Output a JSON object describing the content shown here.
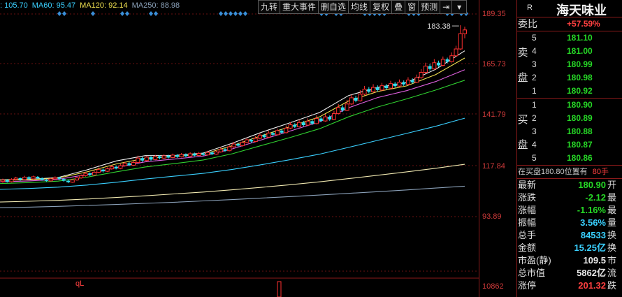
{
  "ma_legend": [
    {
      "label": ": 105.70",
      "color": "#3ad0ff"
    },
    {
      "label": "MA60: 95.47",
      "color": "#3ad0ff"
    },
    {
      "label": "MA120: 92.14",
      "color": "#f0e050"
    },
    {
      "label": "MA250: 88.98",
      "color": "#8aa0b8"
    }
  ],
  "toolbar": [
    "九转",
    "重大事件",
    "删自选",
    "均线",
    "复权",
    "叠",
    "窗",
    "预测"
  ],
  "price_axis": [
    "189.35",
    "165.73",
    "141.79",
    "117.84",
    "93.89",
    "10862"
  ],
  "chart": {
    "high_label": "183.38",
    "indicator_label": "qL",
    "price_min": 80.0,
    "price_max": 189.35,
    "candles": [
      {
        "o": 100.5,
        "c": 101.2,
        "h": 102.0,
        "l": 99.8
      },
      {
        "o": 101.2,
        "c": 100.4,
        "h": 101.8,
        "l": 99.9
      },
      {
        "o": 100.4,
        "c": 101.6,
        "h": 102.2,
        "l": 100.0
      },
      {
        "o": 101.6,
        "c": 102.3,
        "h": 103.0,
        "l": 101.0
      },
      {
        "o": 102.3,
        "c": 101.5,
        "h": 102.6,
        "l": 100.8
      },
      {
        "o": 101.5,
        "c": 102.8,
        "h": 103.5,
        "l": 101.2
      },
      {
        "o": 102.8,
        "c": 101.9,
        "h": 103.3,
        "l": 101.4
      },
      {
        "o": 101.9,
        "c": 103.0,
        "h": 103.6,
        "l": 101.5
      },
      {
        "o": 103.0,
        "c": 102.2,
        "h": 103.4,
        "l": 101.8
      },
      {
        "o": 102.2,
        "c": 101.4,
        "h": 102.7,
        "l": 100.9
      },
      {
        "o": 101.4,
        "c": 100.8,
        "h": 101.9,
        "l": 100.2
      },
      {
        "o": 100.8,
        "c": 101.9,
        "h": 102.3,
        "l": 100.5
      },
      {
        "o": 101.9,
        "c": 102.6,
        "h": 103.2,
        "l": 101.5
      },
      {
        "o": 102.6,
        "c": 101.8,
        "h": 103.0,
        "l": 101.3
      },
      {
        "o": 101.8,
        "c": 100.9,
        "h": 102.2,
        "l": 100.4
      },
      {
        "o": 100.9,
        "c": 100.1,
        "h": 101.4,
        "l": 99.6
      },
      {
        "o": 100.1,
        "c": 101.3,
        "h": 101.9,
        "l": 99.8
      },
      {
        "o": 101.3,
        "c": 102.4,
        "h": 102.9,
        "l": 100.9
      },
      {
        "o": 102.4,
        "c": 103.6,
        "h": 104.2,
        "l": 102.0
      },
      {
        "o": 103.6,
        "c": 104.8,
        "h": 105.6,
        "l": 103.1
      },
      {
        "o": 104.8,
        "c": 103.9,
        "h": 105.3,
        "l": 103.4
      },
      {
        "o": 103.9,
        "c": 105.4,
        "h": 106.2,
        "l": 103.5
      },
      {
        "o": 105.4,
        "c": 106.8,
        "h": 107.9,
        "l": 105.0
      },
      {
        "o": 106.8,
        "c": 105.9,
        "h": 107.4,
        "l": 105.2
      },
      {
        "o": 105.9,
        "c": 107.2,
        "h": 108.0,
        "l": 105.5
      },
      {
        "o": 107.2,
        "c": 108.3,
        "h": 109.1,
        "l": 106.7
      },
      {
        "o": 108.3,
        "c": 107.4,
        "h": 109.0,
        "l": 106.9
      },
      {
        "o": 107.4,
        "c": 108.9,
        "h": 109.8,
        "l": 107.0
      },
      {
        "o": 108.9,
        "c": 110.2,
        "h": 111.0,
        "l": 108.4
      },
      {
        "o": 110.2,
        "c": 109.1,
        "h": 110.9,
        "l": 108.6
      },
      {
        "o": 109.1,
        "c": 110.6,
        "h": 111.5,
        "l": 108.8
      },
      {
        "o": 110.6,
        "c": 112.9,
        "h": 114.2,
        "l": 110.1
      },
      {
        "o": 112.9,
        "c": 111.6,
        "h": 113.5,
        "l": 110.9
      },
      {
        "o": 111.6,
        "c": 113.4,
        "h": 114.0,
        "l": 111.2
      },
      {
        "o": 113.4,
        "c": 112.1,
        "h": 113.9,
        "l": 111.5
      },
      {
        "o": 112.1,
        "c": 113.8,
        "h": 114.6,
        "l": 111.8
      },
      {
        "o": 113.8,
        "c": 112.9,
        "h": 114.3,
        "l": 112.2
      },
      {
        "o": 112.9,
        "c": 114.1,
        "h": 114.9,
        "l": 112.5
      },
      {
        "o": 114.1,
        "c": 113.2,
        "h": 114.7,
        "l": 112.7
      },
      {
        "o": 113.2,
        "c": 114.5,
        "h": 115.3,
        "l": 112.9
      },
      {
        "o": 114.5,
        "c": 113.6,
        "h": 115.0,
        "l": 113.0
      },
      {
        "o": 113.6,
        "c": 114.8,
        "h": 115.6,
        "l": 113.2
      },
      {
        "o": 114.8,
        "c": 113.9,
        "h": 115.4,
        "l": 113.4
      },
      {
        "o": 113.9,
        "c": 115.2,
        "h": 116.0,
        "l": 113.6
      },
      {
        "o": 115.2,
        "c": 114.3,
        "h": 115.8,
        "l": 113.9
      },
      {
        "o": 114.3,
        "c": 115.4,
        "h": 116.2,
        "l": 114.0
      },
      {
        "o": 115.4,
        "c": 114.6,
        "h": 116.0,
        "l": 114.1
      },
      {
        "o": 114.6,
        "c": 115.9,
        "h": 116.8,
        "l": 114.2
      },
      {
        "o": 115.9,
        "c": 115.0,
        "h": 116.4,
        "l": 114.5
      },
      {
        "o": 115.0,
        "c": 116.2,
        "h": 117.1,
        "l": 114.7
      },
      {
        "o": 116.2,
        "c": 117.6,
        "h": 118.5,
        "l": 115.8
      },
      {
        "o": 117.6,
        "c": 116.8,
        "h": 118.2,
        "l": 116.2
      },
      {
        "o": 116.8,
        "c": 118.9,
        "h": 119.8,
        "l": 116.5
      },
      {
        "o": 118.9,
        "c": 120.4,
        "h": 121.5,
        "l": 118.4
      },
      {
        "o": 120.4,
        "c": 119.5,
        "h": 121.0,
        "l": 118.9
      },
      {
        "o": 119.5,
        "c": 121.2,
        "h": 122.3,
        "l": 119.0
      },
      {
        "o": 121.2,
        "c": 122.6,
        "h": 123.5,
        "l": 120.7
      },
      {
        "o": 122.6,
        "c": 121.7,
        "h": 123.2,
        "l": 121.0
      },
      {
        "o": 121.7,
        "c": 123.4,
        "h": 124.6,
        "l": 121.3
      },
      {
        "o": 123.4,
        "c": 125.1,
        "h": 126.0,
        "l": 122.9
      },
      {
        "o": 125.1,
        "c": 124.0,
        "h": 125.8,
        "l": 123.4
      },
      {
        "o": 124.0,
        "c": 126.2,
        "h": 127.4,
        "l": 123.6
      },
      {
        "o": 126.2,
        "c": 125.3,
        "h": 127.0,
        "l": 124.7
      },
      {
        "o": 125.3,
        "c": 127.5,
        "h": 128.6,
        "l": 124.9
      },
      {
        "o": 127.5,
        "c": 126.4,
        "h": 128.3,
        "l": 125.8
      },
      {
        "o": 126.4,
        "c": 128.8,
        "h": 130.2,
        "l": 126.0
      },
      {
        "o": 128.8,
        "c": 130.6,
        "h": 131.9,
        "l": 128.2
      },
      {
        "o": 130.6,
        "c": 129.5,
        "h": 131.4,
        "l": 128.8
      },
      {
        "o": 129.5,
        "c": 131.8,
        "h": 133.2,
        "l": 129.1
      },
      {
        "o": 131.8,
        "c": 130.4,
        "h": 132.6,
        "l": 129.7
      },
      {
        "o": 130.4,
        "c": 132.5,
        "h": 134.0,
        "l": 130.0
      },
      {
        "o": 132.5,
        "c": 131.2,
        "h": 133.4,
        "l": 130.5
      },
      {
        "o": 131.2,
        "c": 133.9,
        "h": 135.6,
        "l": 130.8
      },
      {
        "o": 133.9,
        "c": 132.6,
        "h": 134.8,
        "l": 131.9
      },
      {
        "o": 132.6,
        "c": 134.8,
        "h": 136.2,
        "l": 132.2
      },
      {
        "o": 134.8,
        "c": 133.4,
        "h": 135.5,
        "l": 132.7
      },
      {
        "o": 133.4,
        "c": 136.5,
        "h": 138.0,
        "l": 133.0
      },
      {
        "o": 136.5,
        "c": 139.8,
        "h": 141.6,
        "l": 136.0
      },
      {
        "o": 139.8,
        "c": 138.2,
        "h": 140.9,
        "l": 137.4
      },
      {
        "o": 138.2,
        "c": 141.6,
        "h": 143.8,
        "l": 137.8
      },
      {
        "o": 141.6,
        "c": 144.9,
        "h": 146.5,
        "l": 141.0
      },
      {
        "o": 144.9,
        "c": 143.3,
        "h": 146.0,
        "l": 142.5
      },
      {
        "o": 143.3,
        "c": 146.8,
        "h": 148.9,
        "l": 142.9
      },
      {
        "o": 146.8,
        "c": 149.5,
        "h": 151.2,
        "l": 146.2
      },
      {
        "o": 149.5,
        "c": 148.1,
        "h": 150.6,
        "l": 147.3
      },
      {
        "o": 148.1,
        "c": 150.4,
        "h": 152.1,
        "l": 147.6
      },
      {
        "o": 150.4,
        "c": 149.0,
        "h": 151.5,
        "l": 148.2
      },
      {
        "o": 149.0,
        "c": 151.3,
        "h": 152.8,
        "l": 148.5
      },
      {
        "o": 151.3,
        "c": 150.0,
        "h": 152.2,
        "l": 149.2
      },
      {
        "o": 150.0,
        "c": 152.4,
        "h": 153.9,
        "l": 149.5
      },
      {
        "o": 152.4,
        "c": 151.1,
        "h": 153.3,
        "l": 150.3
      },
      {
        "o": 151.1,
        "c": 153.2,
        "h": 154.6,
        "l": 150.6
      },
      {
        "o": 153.2,
        "c": 152.0,
        "h": 154.1,
        "l": 151.2
      },
      {
        "o": 152.0,
        "c": 154.3,
        "h": 155.8,
        "l": 151.5
      },
      {
        "o": 154.3,
        "c": 153.1,
        "h": 155.2,
        "l": 152.4
      },
      {
        "o": 153.1,
        "c": 155.6,
        "h": 157.2,
        "l": 152.7
      },
      {
        "o": 155.6,
        "c": 158.4,
        "h": 160.1,
        "l": 155.0
      },
      {
        "o": 158.4,
        "c": 161.7,
        "h": 163.5,
        "l": 157.8
      },
      {
        "o": 161.7,
        "c": 160.2,
        "h": 162.9,
        "l": 159.3
      },
      {
        "o": 160.2,
        "c": 163.5,
        "h": 165.4,
        "l": 159.7
      },
      {
        "o": 163.5,
        "c": 162.1,
        "h": 164.6,
        "l": 161.3
      },
      {
        "o": 162.1,
        "c": 165.3,
        "h": 166.8,
        "l": 161.6
      },
      {
        "o": 165.3,
        "c": 164.0,
        "h": 166.2,
        "l": 163.2
      },
      {
        "o": 164.0,
        "c": 167.2,
        "h": 168.9,
        "l": 163.6
      },
      {
        "o": 167.2,
        "c": 170.8,
        "h": 172.5,
        "l": 166.6
      },
      {
        "o": 170.8,
        "c": 178.9,
        "h": 183.38,
        "l": 170.2
      },
      {
        "o": 178.9,
        "c": 180.9,
        "h": 182.6,
        "l": 176.4
      }
    ],
    "ma_series": [
      {
        "name": "MA5",
        "color": "#f0f0f0",
        "values": [
          101.4,
          101.6,
          102.6,
          106.7,
          111.4,
          114.2,
          114.3,
          115.6,
          120.8,
          126.6,
          131.7,
          137.1,
          146.1,
          150.4,
          153.0,
          160.0,
          169.8
        ]
      },
      {
        "name": "MA10",
        "color": "#f0e050",
        "values": [
          101.2,
          101.4,
          102.3,
          105.6,
          109.8,
          112.8,
          113.7,
          115.0,
          119.5,
          124.8,
          129.6,
          134.8,
          143.2,
          148.2,
          151.2,
          157.2,
          166.0
        ]
      },
      {
        "name": "MA20",
        "color": "#e060e0",
        "values": [
          100.3,
          100.8,
          101.6,
          104.2,
          107.9,
          110.9,
          112.4,
          114.0,
          117.8,
          122.6,
          127.3,
          132.1,
          139.6,
          145.0,
          148.7,
          153.5,
          159.8
        ]
      },
      {
        "name": "MA30",
        "color": "#30d030",
        "values": [
          99.4,
          99.9,
          100.7,
          102.8,
          105.6,
          108.2,
          110.0,
          111.9,
          115.2,
          119.6,
          123.9,
          128.5,
          134.8,
          140.0,
          144.3,
          149.0,
          154.2
        ]
      },
      {
        "name": "MA60",
        "color": "#3ad0ff",
        "values": [
          96.3,
          96.8,
          97.5,
          98.6,
          100.1,
          101.8,
          103.3,
          104.8,
          106.9,
          109.4,
          112.1,
          115.0,
          118.6,
          122.3,
          126.0,
          129.8,
          134.1
        ]
      },
      {
        "name": "MA120",
        "color": "#f0e8b0",
        "values": [
          89.6,
          90.0,
          90.5,
          91.2,
          92.0,
          92.9,
          93.9,
          94.9,
          96.1,
          97.4,
          98.8,
          100.3,
          102.0,
          103.8,
          105.6,
          107.5,
          109.6
        ]
      },
      {
        "name": "MA250",
        "color": "#8aa0b8",
        "values": [
          86.6,
          86.9,
          87.3,
          87.8,
          88.3,
          88.9,
          89.5,
          90.2,
          90.9,
          91.7,
          92.5,
          93.3,
          94.2,
          95.1,
          96.0,
          97.0,
          98.0
        ]
      }
    ]
  },
  "quote": {
    "r_badge": "R",
    "name": "海天味业",
    "weibi_label": "委比",
    "weibi_value": "+57.59%",
    "sell_label": "卖盘",
    "buy_label": "买盘",
    "asks": [
      {
        "level": "5",
        "price": "181.10"
      },
      {
        "level": "4",
        "price": "181.00"
      },
      {
        "level": "3",
        "price": "180.99"
      },
      {
        "level": "2",
        "price": "180.98"
      },
      {
        "level": "1",
        "price": "180.92"
      }
    ],
    "bids": [
      {
        "level": "1",
        "price": "180.90"
      },
      {
        "level": "2",
        "price": "180.89"
      },
      {
        "level": "3",
        "price": "180.88"
      },
      {
        "level": "4",
        "price": "180.87"
      },
      {
        "level": "5",
        "price": "180.86"
      }
    ],
    "bid_note": "在买盘180.80位置有",
    "bid_note_amount": "80手",
    "stats": [
      {
        "label": "最新",
        "value": "180.90",
        "color": "#26d826",
        "tail": "开"
      },
      {
        "label": "涨跌",
        "value": "-2.12",
        "color": "#26d826",
        "tail": "最"
      },
      {
        "label": "涨幅",
        "value": "-1.16%",
        "color": "#26d826",
        "tail": "最"
      },
      {
        "label": "振幅",
        "value": "3.56%",
        "color": "#3ad0ff",
        "tail": "量"
      },
      {
        "label": "总手",
        "value": "84533",
        "color": "#3ad0ff",
        "tail": "换"
      },
      {
        "label": "金额",
        "value": "15.25亿",
        "color": "#3ad0ff",
        "tail": "换"
      },
      {
        "label": "市盈(静)",
        "value": "109.5",
        "color": "#e8e8e8",
        "tail": "市"
      },
      {
        "label": "总市值",
        "value": "5862亿",
        "color": "#e8e8e8",
        "tail": "流"
      },
      {
        "label": "涨停",
        "value": "201.32",
        "color": "#ff4040",
        "tail": "跌"
      }
    ]
  }
}
